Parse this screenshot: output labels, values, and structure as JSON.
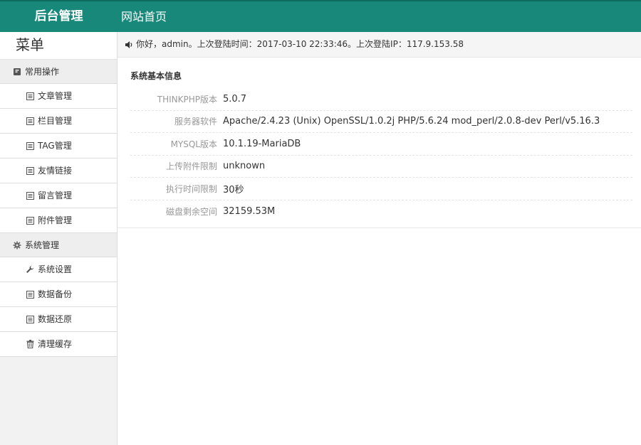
{
  "header": {
    "brand": "后台管理",
    "nav_home": "网站首页"
  },
  "sidebar": {
    "title": "菜单",
    "groups": [
      {
        "label": "常用操作",
        "icon": "book-icon",
        "items": [
          {
            "label": "文章管理",
            "icon": "list-icon"
          },
          {
            "label": "栏目管理",
            "icon": "list-icon"
          },
          {
            "label": "TAG管理",
            "icon": "list-icon"
          },
          {
            "label": "友情链接",
            "icon": "list-icon"
          },
          {
            "label": "留言管理",
            "icon": "list-icon"
          },
          {
            "label": "附件管理",
            "icon": "list-icon"
          }
        ]
      },
      {
        "label": "系统管理",
        "icon": "gear-icon",
        "items": [
          {
            "label": "系统设置",
            "icon": "wrench-icon"
          },
          {
            "label": "数据备份",
            "icon": "list-icon"
          },
          {
            "label": "数据还原",
            "icon": "list-icon"
          },
          {
            "label": "清理缓存",
            "icon": "trash-icon"
          }
        ]
      }
    ]
  },
  "welcome": {
    "icon": "speaker-icon",
    "text": "你好，admin。上次登陆时间：2017-03-10 22:33:46。上次登陆IP：117.9.153.58"
  },
  "system_info": {
    "title": "系统基本信息",
    "rows": [
      {
        "label": "THINKPHP版本",
        "value": "5.0.7"
      },
      {
        "label": "服务器软件",
        "value": "Apache/2.4.23 (Unix) OpenSSL/1.0.2j PHP/5.6.24 mod_perl/2.0.8-dev Perl/v5.16.3"
      },
      {
        "label": "MYSQL版本",
        "value": "10.1.19-MariaDB"
      },
      {
        "label": "上传附件限制",
        "value": "unknown"
      },
      {
        "label": "执行时间限制",
        "value": "30秒"
      },
      {
        "label": "磁盘剩余空间",
        "value": "32159.53M"
      }
    ]
  },
  "colors": {
    "header_bg": "#17887a",
    "sidebar_bg": "#f2f2f2"
  }
}
